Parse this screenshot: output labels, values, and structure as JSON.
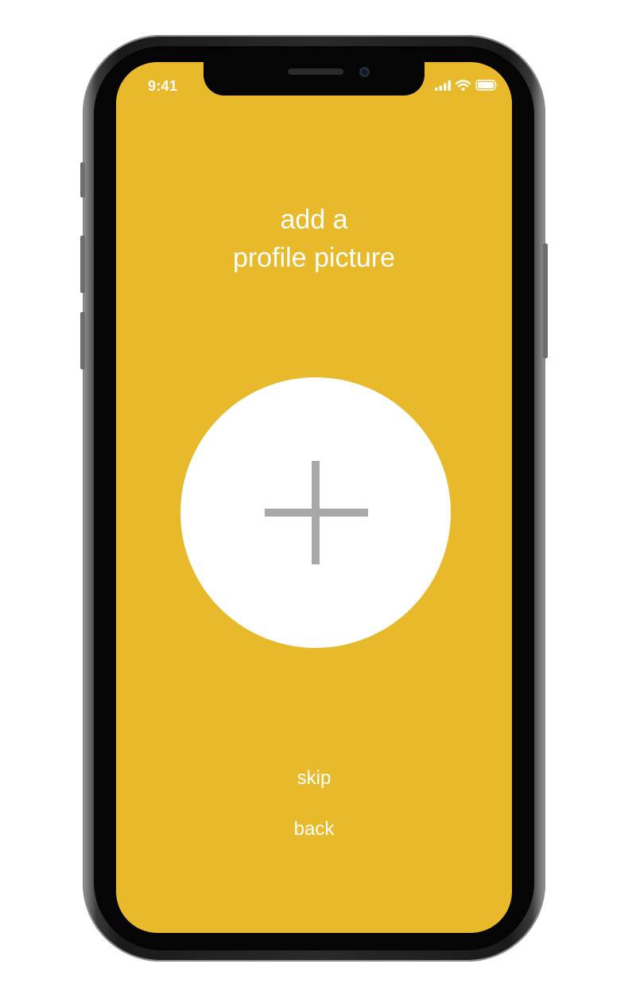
{
  "status_bar": {
    "time": "9:41",
    "icons": [
      "cellular-signal-icon",
      "wifi-icon",
      "battery-icon"
    ]
  },
  "onboarding": {
    "title_line1": "add a",
    "title_line2": "profile picture",
    "add_photo_icon": "plus-icon",
    "skip_label": "skip",
    "back_label": "back"
  },
  "colors": {
    "screen_background": "#E8B92B",
    "text": "#FFFFFF",
    "photo_circle": "#FFFFFF",
    "plus": "#A8A8A8"
  }
}
